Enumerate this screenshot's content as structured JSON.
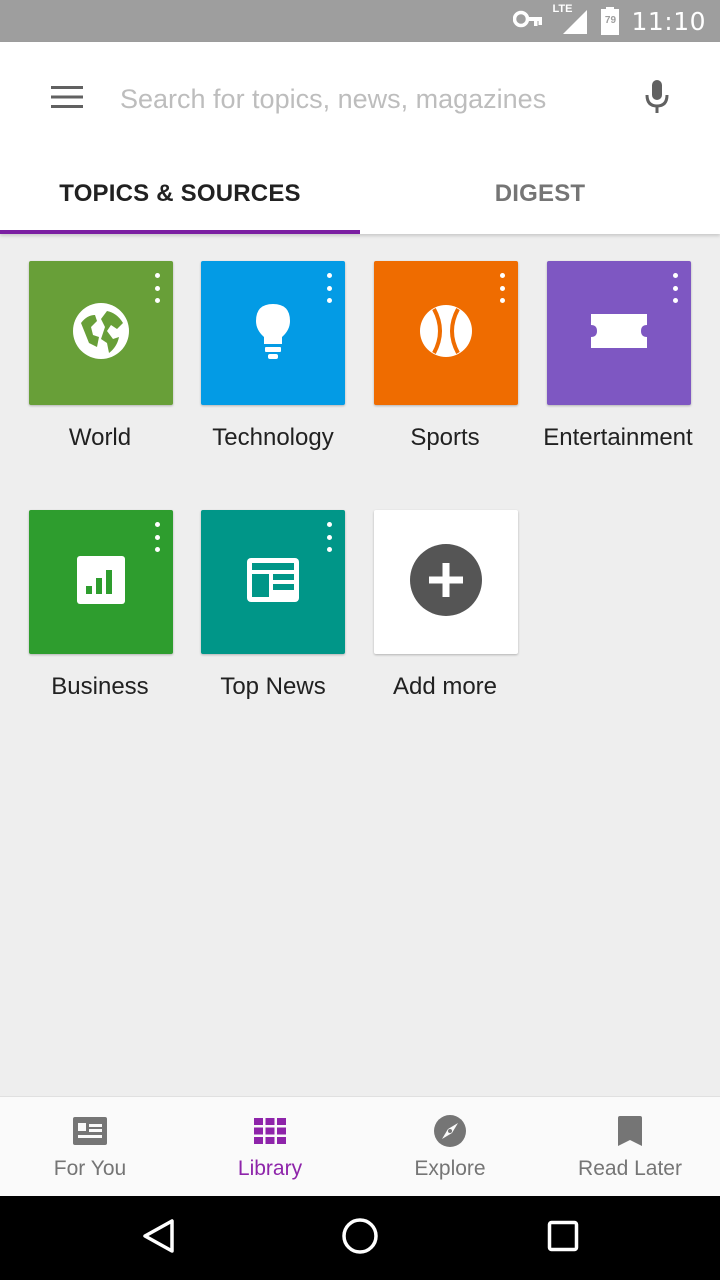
{
  "status_bar": {
    "time": "11:10",
    "network_label": "LTE",
    "battery_level": "79"
  },
  "search": {
    "placeholder": "Search for topics, news, magazines"
  },
  "tabs": [
    {
      "label": "TOPICS & SOURCES",
      "active": true
    },
    {
      "label": "DIGEST",
      "active": false
    }
  ],
  "topics": [
    {
      "label": "World",
      "color": "#689f38",
      "icon": "globe-icon"
    },
    {
      "label": "Technology",
      "color": "#039be5",
      "icon": "lightbulb-icon"
    },
    {
      "label": "Sports",
      "color": "#ef6c00",
      "icon": "ball-icon"
    },
    {
      "label": "Entertainment",
      "color": "#7e57c2",
      "icon": "ticket-icon"
    },
    {
      "label": "Business",
      "color": "#2e9d2e",
      "icon": "bar-chart-icon"
    },
    {
      "label": "Top News",
      "color": "#009688",
      "icon": "newspaper-icon"
    }
  ],
  "add_more": {
    "label": "Add more",
    "icon": "plus-circle-icon"
  },
  "bottom_nav": [
    {
      "label": "For You",
      "icon": "for-you-icon",
      "active": false
    },
    {
      "label": "Library",
      "icon": "library-grid-icon",
      "active": true
    },
    {
      "label": "Explore",
      "icon": "compass-icon",
      "active": false
    },
    {
      "label": "Read Later",
      "icon": "bookmark-icon",
      "active": false
    }
  ],
  "colors": {
    "accent": "#8e24aa",
    "tab_indicator": "#7b1fa2"
  }
}
